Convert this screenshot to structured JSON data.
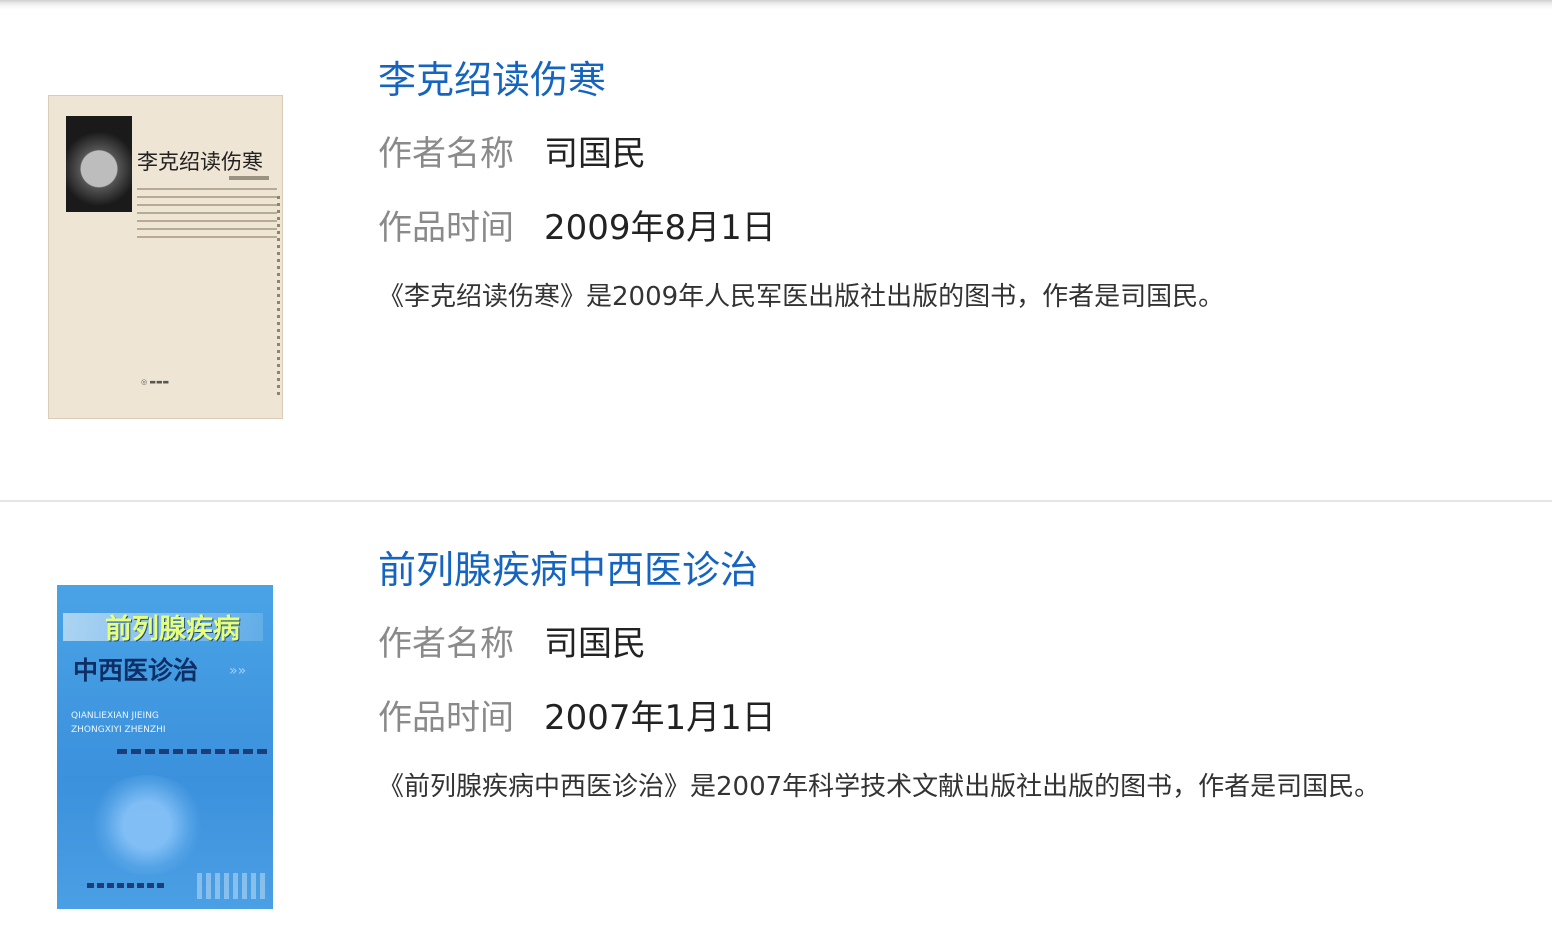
{
  "books": [
    {
      "title": "李克绍读伤寒",
      "author_label": "作者名称",
      "author": "司国民",
      "date_label": "作品时间",
      "date": "2009年8月1日",
      "description": "《李克绍读伤寒》是2009年人民军医出版社出版的图书，作者是司国民。",
      "cover": {
        "title_text": "李克绍读伤寒",
        "background": "#efe5d4"
      }
    },
    {
      "title": "前列腺疾病中西医诊治",
      "author_label": "作者名称",
      "author": "司国民",
      "date_label": "作品时间",
      "date": "2007年1月1日",
      "description": "《前列腺疾病中西医诊治》是2007年科学技术文献出版社出版的图书，作者是司国民。",
      "cover": {
        "title_line1": "前列腺疾病",
        "title_line2": "中西医诊治",
        "english_line1": "QIANLIEXIAN JIEING",
        "english_line2": "ZHONGXIYI ZHENZHI",
        "background": "#3b91dc"
      }
    }
  ],
  "colors": {
    "title_link": "#1565c0",
    "label": "#8a8a8a",
    "divider": "#e6e6e6"
  }
}
